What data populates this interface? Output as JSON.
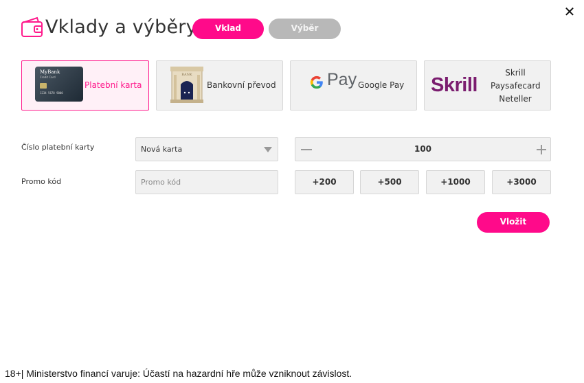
{
  "header": {
    "title": "Vklady a výběry",
    "close_icon": "close-icon",
    "wallet_icon": "wallet-icon",
    "tabs": [
      {
        "label": "Vklad",
        "active": true
      },
      {
        "label": "Výběr",
        "active": false
      }
    ]
  },
  "methods": [
    {
      "label": "Platební karta",
      "icon": "credit-card-icon",
      "card_bank": "MyBank",
      "card_type": "Credit Card",
      "card_number": "1234 5678 9000",
      "active": true
    },
    {
      "label": "Bankovní převod",
      "icon": "bank-building-icon",
      "bank_sign": "BANK"
    },
    {
      "label": "Google Pay",
      "logo_text": "Pay",
      "icon": "google-pay-logo"
    },
    {
      "logo_text": "Skrill",
      "labels": [
        "Skrill",
        "Paysafecard",
        "Neteller"
      ],
      "icon": "skrill-logo"
    }
  ],
  "form": {
    "card_label": "Číslo platební karty",
    "card_select_value": "Nová karta",
    "promo_label": "Promo kód",
    "promo_placeholder": "Promo kód",
    "amount": "100",
    "quick_amounts": [
      "+200",
      "+500",
      "+1000",
      "+3000"
    ],
    "submit_label": "Vložit"
  },
  "footer": {
    "disclaimer": "18+| Ministerstvo financí varuje: Účastí na hazardní hře může vzniknout závislost."
  },
  "colors": {
    "accent": "#ff0a8a",
    "inactive_tab": "#b8b8b8",
    "skrill": "#7b1d6f"
  }
}
